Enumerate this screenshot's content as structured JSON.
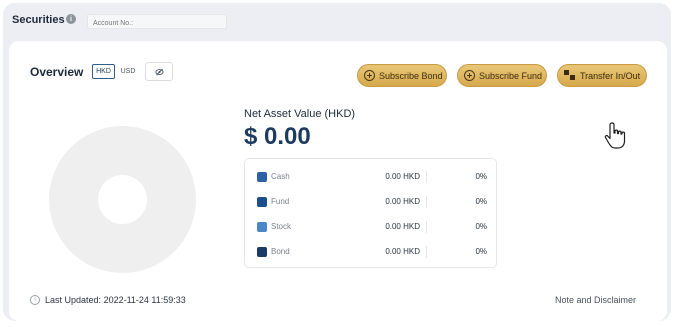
{
  "header": {
    "title": "Securities",
    "info_icon": "info-icon",
    "account_placeholder": "Account No.:"
  },
  "overview": {
    "title": "Overview",
    "currencies": [
      "HKD",
      "USD"
    ],
    "selected_currency": "HKD",
    "eye_icon": "eye-off-icon"
  },
  "actions": {
    "subscribe_bond": "Subscribe Bond",
    "subscribe_fund": "Subscribe Fund",
    "transfer": "Transfer In/Out",
    "accent": "#d6a94c"
  },
  "nav": {
    "label": "Net Asset Value (HKD)",
    "value": "$ 0.00"
  },
  "assets": [
    {
      "name": "Cash",
      "amount": "0.00 HKD",
      "percent": "0%",
      "color": "#2d63a6"
    },
    {
      "name": "Fund",
      "amount": "0.00 HKD",
      "percent": "0%",
      "color": "#1f4e8c"
    },
    {
      "name": "Stock",
      "amount": "0.00 HKD",
      "percent": "0%",
      "color": "#4b86c9"
    },
    {
      "name": "Bond",
      "amount": "0.00 HKD",
      "percent": "0%",
      "color": "#1b3a66"
    }
  ],
  "footer": {
    "last_updated_label": "Last Updated:",
    "last_updated_value": "2022-11-24 11:59:33",
    "note": "Note and Disclaimer"
  }
}
